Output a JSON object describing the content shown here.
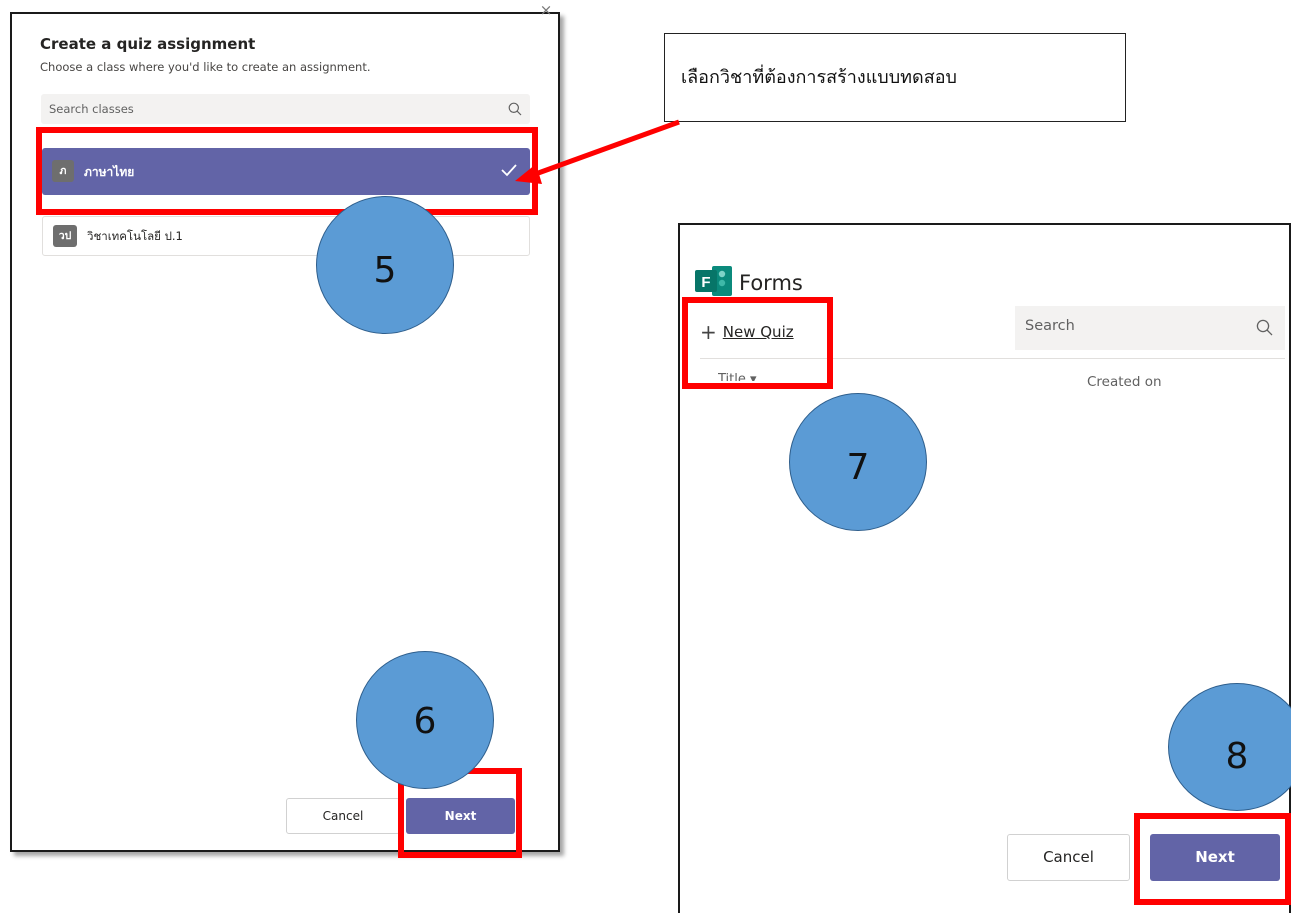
{
  "left_dialog": {
    "close_glyph": "×",
    "title": "Create a quiz assignment",
    "subtitle": "Choose a class where you'd like to create an assignment.",
    "search_placeholder": "Search classes",
    "classes": [
      {
        "initial": "ภ",
        "name": "ภาษาไทย",
        "selected": true
      },
      {
        "initial": "วป",
        "name": "วิชาเทคโนโลยี ป.1",
        "selected": false
      }
    ],
    "cancel_label": "Cancel",
    "next_label": "Next"
  },
  "callout": {
    "text": "เลือกวิชาที่ต้องการสร้างแบบทดสอบ"
  },
  "right_dialog": {
    "app_name": "Forms",
    "logo_letter": "F",
    "new_quiz_label": "New Quiz",
    "search_placeholder": "Search",
    "columns": {
      "title": "Title ▾",
      "created_on": "Created on"
    },
    "cancel_label": "Cancel",
    "next_label": "Next"
  },
  "steps": [
    "5",
    "6",
    "7",
    "8"
  ],
  "colors": {
    "accent_purple": "#6264a7",
    "highlight_red": "#ff0000",
    "step_blue": "#5b9bd5",
    "forms_green": "#077568",
    "arrow_red": "#ff0000"
  },
  "icons": {
    "search": "search-icon",
    "checkmark": "checkmark-icon",
    "plus": "plus-icon",
    "close": "close-icon",
    "forms_logo": "forms-logo-icon"
  }
}
